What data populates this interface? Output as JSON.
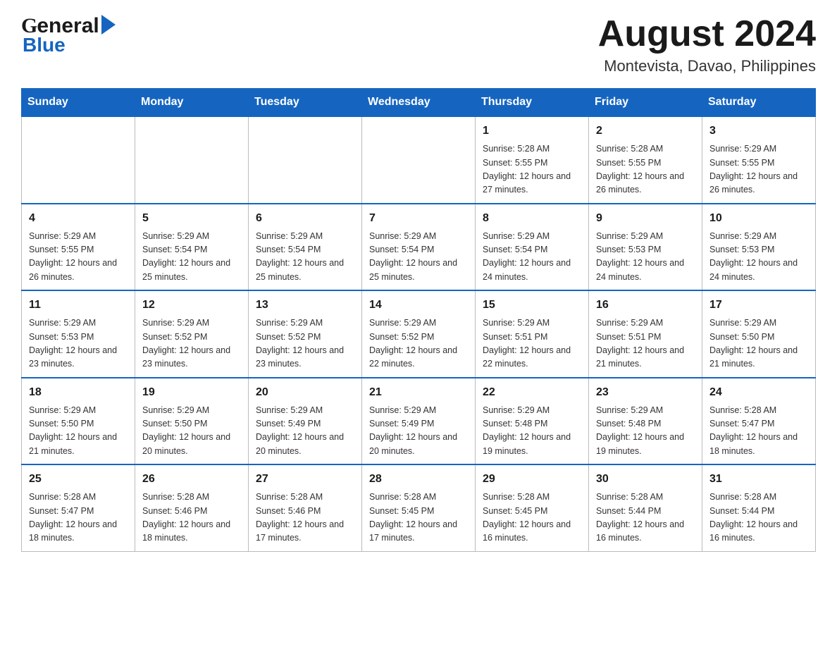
{
  "logo": {
    "general": "General",
    "blue": "Blue"
  },
  "header": {
    "month_year": "August 2024",
    "location": "Montevista, Davao, Philippines"
  },
  "weekdays": [
    "Sunday",
    "Monday",
    "Tuesday",
    "Wednesday",
    "Thursday",
    "Friday",
    "Saturday"
  ],
  "weeks": [
    [
      {
        "day": "",
        "info": ""
      },
      {
        "day": "",
        "info": ""
      },
      {
        "day": "",
        "info": ""
      },
      {
        "day": "",
        "info": ""
      },
      {
        "day": "1",
        "info": "Sunrise: 5:28 AM\nSunset: 5:55 PM\nDaylight: 12 hours\nand 27 minutes."
      },
      {
        "day": "2",
        "info": "Sunrise: 5:28 AM\nSunset: 5:55 PM\nDaylight: 12 hours\nand 26 minutes."
      },
      {
        "day": "3",
        "info": "Sunrise: 5:29 AM\nSunset: 5:55 PM\nDaylight: 12 hours\nand 26 minutes."
      }
    ],
    [
      {
        "day": "4",
        "info": "Sunrise: 5:29 AM\nSunset: 5:55 PM\nDaylight: 12 hours\nand 26 minutes."
      },
      {
        "day": "5",
        "info": "Sunrise: 5:29 AM\nSunset: 5:54 PM\nDaylight: 12 hours\nand 25 minutes."
      },
      {
        "day": "6",
        "info": "Sunrise: 5:29 AM\nSunset: 5:54 PM\nDaylight: 12 hours\nand 25 minutes."
      },
      {
        "day": "7",
        "info": "Sunrise: 5:29 AM\nSunset: 5:54 PM\nDaylight: 12 hours\nand 25 minutes."
      },
      {
        "day": "8",
        "info": "Sunrise: 5:29 AM\nSunset: 5:54 PM\nDaylight: 12 hours\nand 24 minutes."
      },
      {
        "day": "9",
        "info": "Sunrise: 5:29 AM\nSunset: 5:53 PM\nDaylight: 12 hours\nand 24 minutes."
      },
      {
        "day": "10",
        "info": "Sunrise: 5:29 AM\nSunset: 5:53 PM\nDaylight: 12 hours\nand 24 minutes."
      }
    ],
    [
      {
        "day": "11",
        "info": "Sunrise: 5:29 AM\nSunset: 5:53 PM\nDaylight: 12 hours\nand 23 minutes."
      },
      {
        "day": "12",
        "info": "Sunrise: 5:29 AM\nSunset: 5:52 PM\nDaylight: 12 hours\nand 23 minutes."
      },
      {
        "day": "13",
        "info": "Sunrise: 5:29 AM\nSunset: 5:52 PM\nDaylight: 12 hours\nand 23 minutes."
      },
      {
        "day": "14",
        "info": "Sunrise: 5:29 AM\nSunset: 5:52 PM\nDaylight: 12 hours\nand 22 minutes."
      },
      {
        "day": "15",
        "info": "Sunrise: 5:29 AM\nSunset: 5:51 PM\nDaylight: 12 hours\nand 22 minutes."
      },
      {
        "day": "16",
        "info": "Sunrise: 5:29 AM\nSunset: 5:51 PM\nDaylight: 12 hours\nand 21 minutes."
      },
      {
        "day": "17",
        "info": "Sunrise: 5:29 AM\nSunset: 5:50 PM\nDaylight: 12 hours\nand 21 minutes."
      }
    ],
    [
      {
        "day": "18",
        "info": "Sunrise: 5:29 AM\nSunset: 5:50 PM\nDaylight: 12 hours\nand 21 minutes."
      },
      {
        "day": "19",
        "info": "Sunrise: 5:29 AM\nSunset: 5:50 PM\nDaylight: 12 hours\nand 20 minutes."
      },
      {
        "day": "20",
        "info": "Sunrise: 5:29 AM\nSunset: 5:49 PM\nDaylight: 12 hours\nand 20 minutes."
      },
      {
        "day": "21",
        "info": "Sunrise: 5:29 AM\nSunset: 5:49 PM\nDaylight: 12 hours\nand 20 minutes."
      },
      {
        "day": "22",
        "info": "Sunrise: 5:29 AM\nSunset: 5:48 PM\nDaylight: 12 hours\nand 19 minutes."
      },
      {
        "day": "23",
        "info": "Sunrise: 5:29 AM\nSunset: 5:48 PM\nDaylight: 12 hours\nand 19 minutes."
      },
      {
        "day": "24",
        "info": "Sunrise: 5:28 AM\nSunset: 5:47 PM\nDaylight: 12 hours\nand 18 minutes."
      }
    ],
    [
      {
        "day": "25",
        "info": "Sunrise: 5:28 AM\nSunset: 5:47 PM\nDaylight: 12 hours\nand 18 minutes."
      },
      {
        "day": "26",
        "info": "Sunrise: 5:28 AM\nSunset: 5:46 PM\nDaylight: 12 hours\nand 18 minutes."
      },
      {
        "day": "27",
        "info": "Sunrise: 5:28 AM\nSunset: 5:46 PM\nDaylight: 12 hours\nand 17 minutes."
      },
      {
        "day": "28",
        "info": "Sunrise: 5:28 AM\nSunset: 5:45 PM\nDaylight: 12 hours\nand 17 minutes."
      },
      {
        "day": "29",
        "info": "Sunrise: 5:28 AM\nSunset: 5:45 PM\nDaylight: 12 hours\nand 16 minutes."
      },
      {
        "day": "30",
        "info": "Sunrise: 5:28 AM\nSunset: 5:44 PM\nDaylight: 12 hours\nand 16 minutes."
      },
      {
        "day": "31",
        "info": "Sunrise: 5:28 AM\nSunset: 5:44 PM\nDaylight: 12 hours\nand 16 minutes."
      }
    ]
  ]
}
